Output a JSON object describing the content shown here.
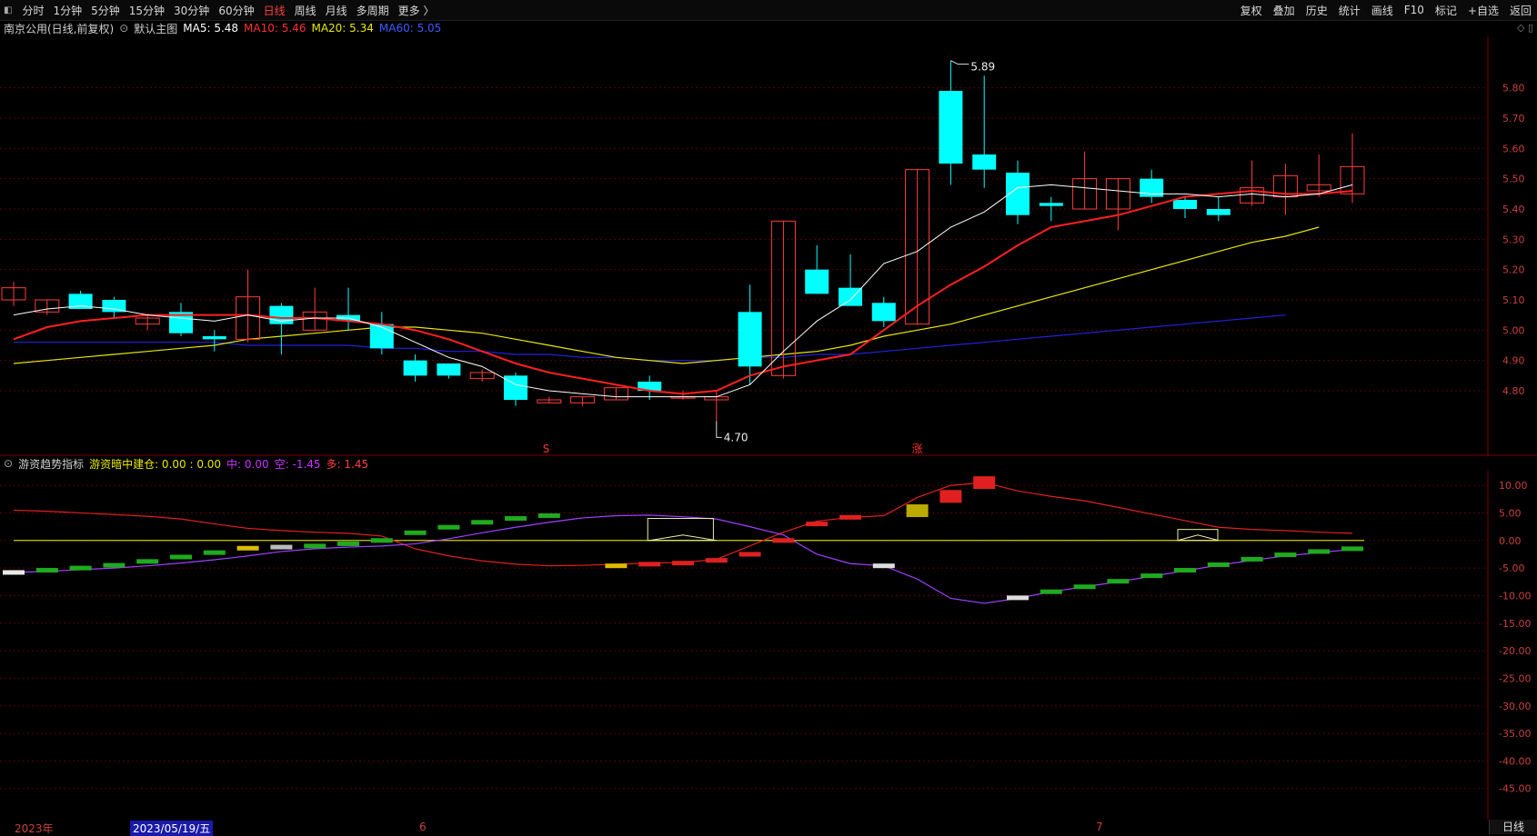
{
  "toolbar": {
    "lead_icon": "collapse-icon",
    "tabs": [
      "分时",
      "1分钟",
      "5分钟",
      "15分钟",
      "30分钟",
      "60分钟",
      "日线",
      "周线",
      "月线",
      "多周期",
      "更多 〉"
    ],
    "active_tab": "日线",
    "tools": [
      "复权",
      "叠加",
      "历史",
      "统计",
      "画线",
      "F10",
      "标记",
      "+自选",
      "返回"
    ]
  },
  "main_legend": {
    "title": "南京公用(日线,前复权)",
    "theme_label": "默认主图",
    "ma5": "MA5: 5.48",
    "ma10": "MA10: 5.46",
    "ma20": "MA20: 5.34",
    "ma60": "MA60: 5.05"
  },
  "sub_legend": {
    "title": "游资趋势指标",
    "build": "游资暗中建仓: 0.00 : 0.00",
    "mid": "中: 0.00",
    "short": "空: -1.45",
    "long": "多: 1.45"
  },
  "colors": {
    "up": "#ff3c3c",
    "down": "#00ffff",
    "ma5": "#ffffff",
    "ma10": "#ff2020",
    "ma20": "#e8e800",
    "ma60": "#2222dd",
    "grid": "#5a0000",
    "axis": "#c84040"
  },
  "price_axis": [
    "5.80",
    "5.70",
    "5.60",
    "5.50",
    "5.40",
    "5.30",
    "5.20",
    "5.10",
    "5.00",
    "4.90",
    "4.80"
  ],
  "sub_axis": [
    "10.00",
    "5.00",
    "0.00",
    "-5.00",
    "-10.00",
    "-15.00",
    "-20.00",
    "-25.00",
    "-30.00",
    "-35.00",
    "-40.00",
    "-45.00"
  ],
  "annotations": {
    "high": "5.89",
    "low": "4.70",
    "marker_s": "S",
    "marker_zhang": "涨"
  },
  "time_axis": {
    "year": "2023年",
    "cursor_date": "2023/05/19/五",
    "month6": "6",
    "month7": "7"
  },
  "period_button": "日线",
  "chart_data": {
    "type": "candlestick",
    "ylim": [
      4.65,
      5.97
    ],
    "candles": [
      [
        5.1,
        5.14,
        5.08,
        5.16
      ],
      [
        5.06,
        5.1,
        5.05,
        5.1
      ],
      [
        5.12,
        5.07,
        5.07,
        5.13
      ],
      [
        5.1,
        5.06,
        5.04,
        5.11
      ],
      [
        5.02,
        5.04,
        5.0,
        5.05
      ],
      [
        5.06,
        4.99,
        4.98,
        5.09
      ],
      [
        4.98,
        4.97,
        4.93,
        5.0
      ],
      [
        4.97,
        5.11,
        4.96,
        5.2
      ],
      [
        5.08,
        5.02,
        4.92,
        5.09
      ],
      [
        5.0,
        5.06,
        5.0,
        5.14
      ],
      [
        5.05,
        5.03,
        5.0,
        5.14
      ],
      [
        5.02,
        4.94,
        4.92,
        5.06
      ],
      [
        4.9,
        4.85,
        4.83,
        4.92
      ],
      [
        4.89,
        4.85,
        4.84,
        4.89
      ],
      [
        4.84,
        4.86,
        4.83,
        4.87
      ],
      [
        4.85,
        4.77,
        4.75,
        4.86
      ],
      [
        4.76,
        4.77,
        4.76,
        4.78
      ],
      [
        4.76,
        4.78,
        4.75,
        4.78
      ],
      [
        4.77,
        4.81,
        4.77,
        4.81
      ],
      [
        4.83,
        4.8,
        4.77,
        4.85
      ],
      [
        4.78,
        4.78,
        4.77,
        4.8
      ],
      [
        4.77,
        4.78,
        4.7,
        4.8
      ],
      [
        5.06,
        4.88,
        4.82,
        5.15
      ],
      [
        4.85,
        5.36,
        4.84,
        5.36
      ],
      [
        5.2,
        5.12,
        5.12,
        5.28
      ],
      [
        5.14,
        5.08,
        5.08,
        5.25
      ],
      [
        5.09,
        5.03,
        5.01,
        5.11
      ],
      [
        5.02,
        5.53,
        5.02,
        5.53
      ],
      [
        5.79,
        5.55,
        5.48,
        5.89
      ],
      [
        5.58,
        5.53,
        5.47,
        5.84
      ],
      [
        5.52,
        5.38,
        5.35,
        5.56
      ],
      [
        5.42,
        5.41,
        5.36,
        5.44
      ],
      [
        5.4,
        5.5,
        5.4,
        5.59
      ],
      [
        5.4,
        5.5,
        5.33,
        5.5
      ],
      [
        5.5,
        5.44,
        5.42,
        5.53
      ],
      [
        5.43,
        5.4,
        5.37,
        5.44
      ],
      [
        5.4,
        5.38,
        5.36,
        5.44
      ],
      [
        5.42,
        5.47,
        5.41,
        5.56
      ],
      [
        5.44,
        5.51,
        5.38,
        5.55
      ],
      [
        5.46,
        5.48,
        5.44,
        5.58
      ],
      [
        5.45,
        5.54,
        5.42,
        5.65
      ]
    ],
    "ma5": [
      5.05,
      5.07,
      5.08,
      5.07,
      5.05,
      5.04,
      5.03,
      5.05,
      5.03,
      5.04,
      5.04,
      5.01,
      4.96,
      4.91,
      4.88,
      4.82,
      4.8,
      4.79,
      4.78,
      4.78,
      4.78,
      4.78,
      4.82,
      4.93,
      5.03,
      5.1,
      5.22,
      5.26,
      5.34,
      5.39,
      5.47,
      5.48,
      5.47,
      5.46,
      5.45,
      5.45,
      5.44,
      5.45,
      5.44,
      5.45,
      5.48
    ],
    "ma10": [
      4.97,
      5.01,
      5.03,
      5.04,
      5.05,
      5.05,
      5.05,
      5.05,
      5.04,
      5.04,
      5.03,
      5.02,
      5.0,
      4.97,
      4.93,
      4.89,
      4.86,
      4.84,
      4.82,
      4.8,
      4.79,
      4.8,
      4.85,
      4.88,
      4.9,
      4.92,
      5.0,
      5.08,
      5.15,
      5.21,
      5.28,
      5.34,
      5.36,
      5.38,
      5.41,
      5.44,
      5.45,
      5.46,
      5.45,
      5.45,
      5.46
    ],
    "ma20": [
      4.89,
      4.9,
      4.91,
      4.92,
      4.93,
      4.94,
      4.95,
      4.97,
      4.98,
      4.99,
      5.0,
      5.01,
      5.01,
      5.0,
      4.99,
      4.97,
      4.95,
      4.93,
      4.91,
      4.9,
      4.89,
      4.9,
      4.91,
      4.92,
      4.93,
      4.95,
      4.98,
      5.0,
      5.02,
      5.05,
      5.08,
      5.11,
      5.14,
      5.17,
      5.2,
      5.23,
      5.26,
      5.29,
      5.31,
      5.34
    ],
    "ma60": [
      4.96,
      4.96,
      4.96,
      4.96,
      4.96,
      4.96,
      4.96,
      4.95,
      4.95,
      4.95,
      4.95,
      4.94,
      4.94,
      4.93,
      4.93,
      4.92,
      4.92,
      4.91,
      4.91,
      4.9,
      4.9,
      4.9,
      4.91,
      4.91,
      4.92,
      4.92,
      4.93,
      4.94,
      4.95,
      4.96,
      4.97,
      4.98,
      4.99,
      5.0,
      5.01,
      5.02,
      5.03,
      5.04,
      5.05
    ],
    "sub_ylim": [
      -49,
      12
    ],
    "red_line": [
      5.5,
      5.3,
      5.0,
      4.7,
      4.4,
      3.9,
      3.0,
      2.2,
      1.8,
      1.5,
      1.3,
      0.8,
      -1.5,
      -2.8,
      -3.7,
      -4.3,
      -4.6,
      -4.5,
      -4.3,
      -4.1,
      -4.0,
      -3.4,
      -1.0,
      1.5,
      3.5,
      4.2,
      4.5,
      7.8,
      10.0,
      10.5,
      9.0,
      8.0,
      7.2,
      6.0,
      4.8,
      3.6,
      2.4,
      2.0,
      1.8,
      1.5,
      1.3
    ],
    "purple_line": [
      -5.8,
      -5.6,
      -5.3,
      -5.0,
      -4.6,
      -4.1,
      -3.5,
      -2.8,
      -2.0,
      -1.5,
      -1.2,
      -1.0,
      -0.6,
      0.3,
      1.4,
      2.4,
      3.3,
      4.1,
      4.5,
      4.6,
      4.3,
      3.9,
      2.5,
      1.0,
      -2.5,
      -4.2,
      -4.6,
      -7.0,
      -10.5,
      -11.4,
      -10.5,
      -9.3,
      -8.4,
      -7.5,
      -6.5,
      -5.5,
      -4.5,
      -3.6,
      -2.8,
      -2.2,
      -1.6
    ],
    "bars": [
      [
        0,
        -5.8,
        "#e8e8e8"
      ],
      [
        1,
        -5.4,
        "#1faa1f"
      ],
      [
        2,
        -5.0,
        "#1faa1f"
      ],
      [
        3,
        -4.5,
        "#1faa1f"
      ],
      [
        4,
        -3.8,
        "#1faa1f"
      ],
      [
        5,
        -3.0,
        "#1faa1f"
      ],
      [
        6,
        -2.2,
        "#1faa1f"
      ],
      [
        7,
        -1.4,
        "#ddbb00"
      ],
      [
        8,
        -1.2,
        "#bbbbbb"
      ],
      [
        9,
        -1.0,
        "#1faa1f"
      ],
      [
        10,
        -0.6,
        "#1faa1f"
      ],
      [
        11,
        0.0,
        "#1faa1f"
      ],
      [
        12,
        1.4,
        "#1faa1f"
      ],
      [
        13,
        2.4,
        "#1faa1f"
      ],
      [
        14,
        3.3,
        "#1faa1f"
      ],
      [
        15,
        4.0,
        "#1faa1f"
      ],
      [
        16,
        4.5,
        "#1faa1f"
      ],
      [
        18,
        -4.6,
        "#ddbb00"
      ],
      [
        19,
        -4.3,
        "#e02020"
      ],
      [
        20,
        -4.1,
        "#e02020"
      ],
      [
        21,
        -3.6,
        "#e02020"
      ],
      [
        22,
        -2.5,
        "#e02020"
      ],
      [
        23,
        0.0,
        "#e02020"
      ],
      [
        24,
        3.0,
        "#e02020"
      ],
      [
        25,
        4.2,
        "#e02020"
      ],
      [
        26,
        -4.6,
        "#dddddd"
      ],
      [
        27,
        5.4,
        "#bbaa00"
      ],
      [
        28,
        8.0,
        "#e02020"
      ],
      [
        29,
        10.5,
        "#e02020"
      ],
      [
        30,
        -10.4,
        "#dddddd"
      ],
      [
        31,
        -9.3,
        "#1faa1f"
      ],
      [
        32,
        -8.4,
        "#1faa1f"
      ],
      [
        33,
        -7.4,
        "#1faa1f"
      ],
      [
        34,
        -6.4,
        "#1faa1f"
      ],
      [
        35,
        -5.4,
        "#1faa1f"
      ],
      [
        36,
        -4.4,
        "#1faa1f"
      ],
      [
        37,
        -3.4,
        "#1faa1f"
      ],
      [
        38,
        -2.6,
        "#1faa1f"
      ],
      [
        39,
        -2.0,
        "#1faa1f"
      ],
      [
        40,
        -1.5,
        "#1faa1f"
      ]
    ]
  }
}
